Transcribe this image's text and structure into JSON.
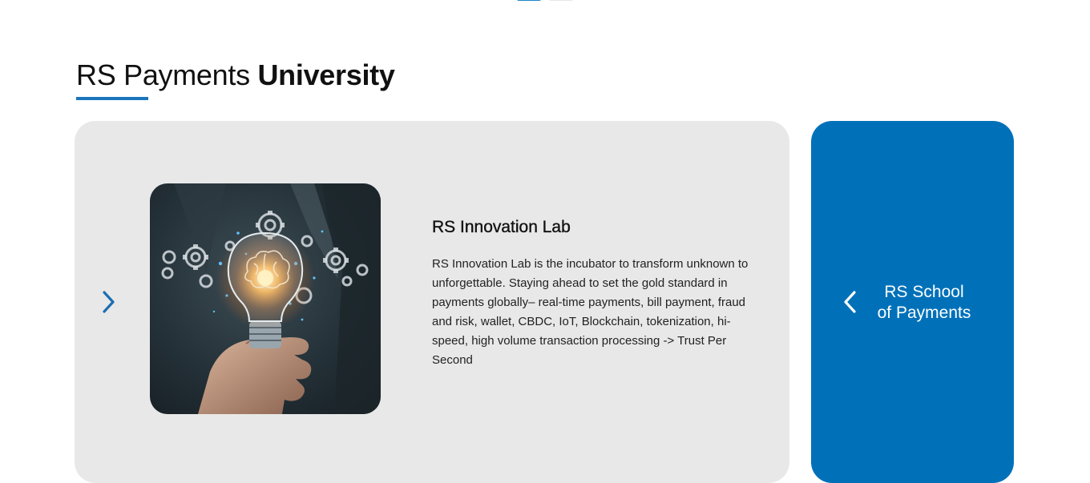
{
  "carousel_indicators": {
    "count": 2,
    "active_index": 0
  },
  "section": {
    "title_light": "RS Payments ",
    "title_bold": "University"
  },
  "main_slide": {
    "image_icon": "lightbulb-brain-gears-image",
    "title": "RS Innovation Lab",
    "description": "RS Innovation Lab is the incubator to transform unknown to unforgettable. Staying ahead to set the gold standard in payments globally– real-time payments, bill payment, fraud and risk, wallet, CBDC, IoT, Blockchain, tokenization, hi-speed, high volume transaction processing -> Trust Per Second",
    "next_icon": "chevron-right-icon"
  },
  "side_slide": {
    "label_line1": "RS School",
    "label_line2": "of Payments",
    "prev_icon": "chevron-left-icon"
  },
  "colors": {
    "accent_blue": "#0071b9",
    "card_gray": "#e8e8e8",
    "underline_blue": "#1a75bb"
  }
}
